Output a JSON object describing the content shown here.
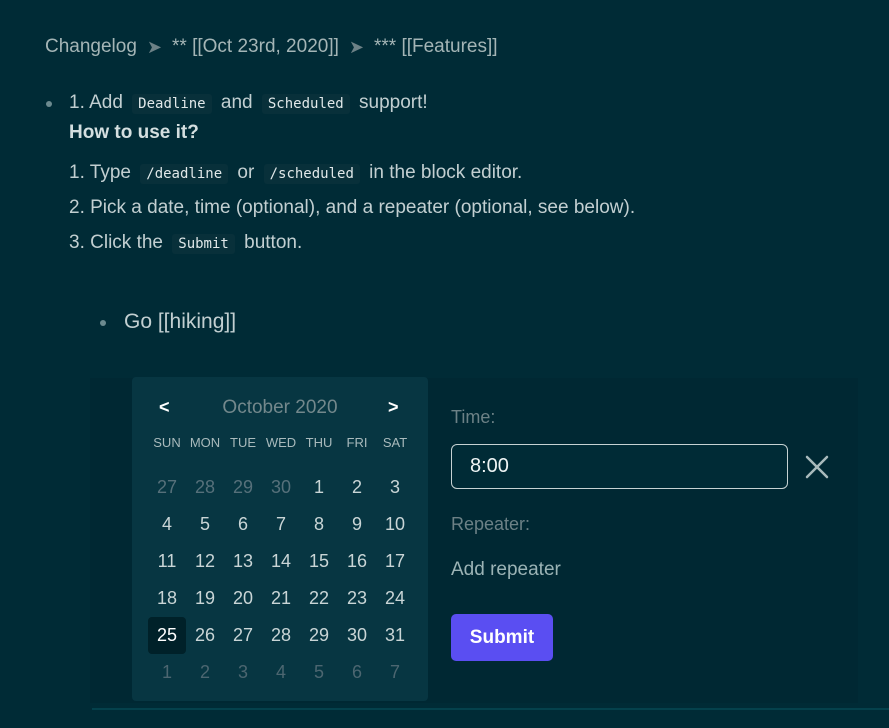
{
  "breadcrumb": {
    "items": [
      "Changelog",
      "** [[Oct 23rd, 2020]]",
      "*** [[Features]]"
    ],
    "separator": "➤"
  },
  "block": {
    "prefix": "1. Add",
    "code1": "Deadline",
    "mid": "and",
    "code2": "Scheduled",
    "suffix": "support!",
    "heading": "How to use it?",
    "steps": [
      {
        "pre": "1. Type",
        "code1": "/deadline",
        "mid": "or",
        "code2": "/scheduled",
        "post": "in the block editor."
      },
      {
        "text": "2. Pick a date, time (optional), and a repeater (optional, see below)."
      },
      {
        "pre": "3. Click the",
        "code": "Submit",
        "post": "button."
      }
    ]
  },
  "child_block": {
    "text": "Go [[hiking]]"
  },
  "calendar": {
    "prev_label": "<",
    "next_label": ">",
    "month_label": "October 2020",
    "weekdays": [
      "SUN",
      "MON",
      "TUE",
      "WED",
      "THU",
      "FRI",
      "SAT"
    ],
    "weeks": [
      [
        "27",
        "28",
        "29",
        "30",
        "1",
        "2",
        "3"
      ],
      [
        "4",
        "5",
        "6",
        "7",
        "8",
        "9",
        "10"
      ],
      [
        "11",
        "12",
        "13",
        "14",
        "15",
        "16",
        "17"
      ],
      [
        "18",
        "19",
        "20",
        "21",
        "22",
        "23",
        "24"
      ],
      [
        "25",
        "26",
        "27",
        "28",
        "29",
        "30",
        "31"
      ],
      [
        "1",
        "2",
        "3",
        "4",
        "5",
        "6",
        "7"
      ]
    ],
    "selected": "25"
  },
  "time": {
    "label": "Time:",
    "value": "8:00"
  },
  "repeater": {
    "label": "Repeater:",
    "add_label": "Add repeater"
  },
  "submit_label": "Submit"
}
